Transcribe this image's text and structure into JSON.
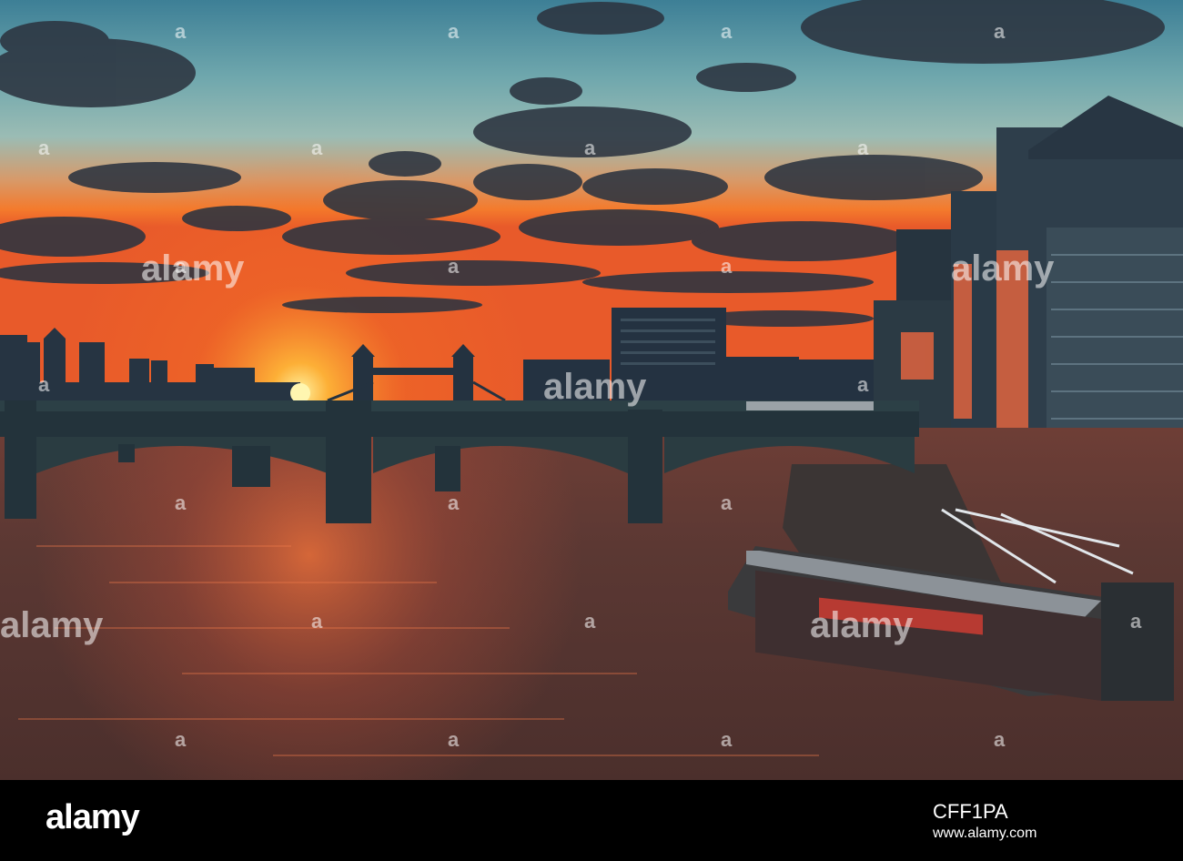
{
  "watermark": {
    "large_text": "alamy",
    "small_text": "a"
  },
  "footer": {
    "logo": "alamy",
    "image_id": "CFF1PA",
    "url": "www.alamy.com"
  },
  "colors": {
    "footer_background": "#000000",
    "sky_top": "#4f8fa3",
    "sunset_orange": "#f07a2a",
    "sun": "#ffe25a",
    "water": "#5a3a33"
  }
}
